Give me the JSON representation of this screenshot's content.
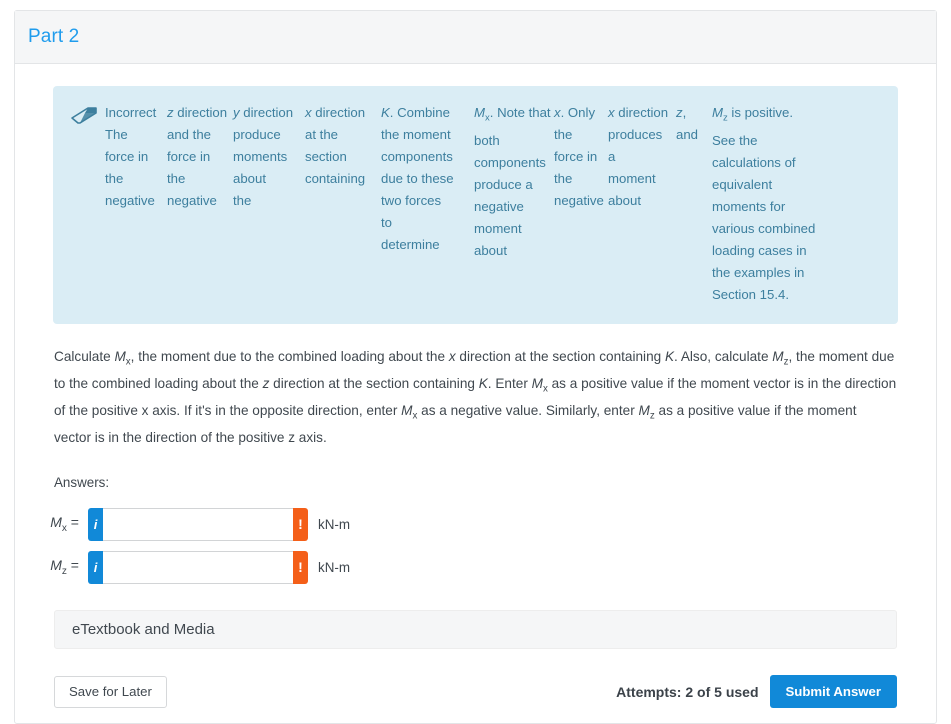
{
  "part": {
    "title": "Part 2"
  },
  "hint": {
    "icon": "eraser-icon",
    "columns": [
      [
        "Incorrect",
        "",
        "The",
        "force in",
        "the",
        "negative"
      ],
      [
        "z direction",
        "and the",
        "force in",
        "the",
        "negative"
      ],
      [
        "y direction",
        "produce",
        "moments",
        "about",
        "the"
      ],
      [
        "x direction",
        "at the",
        "section",
        "containing"
      ],
      [
        "K. Combine",
        "the moment",
        "components",
        "due to these",
        "two forces",
        "to",
        "determine"
      ],
      [
        "Mx. Note that",
        "both",
        "components",
        "produce a",
        "negative",
        "moment",
        "about"
      ],
      [
        "x. Only",
        "the",
        "force in",
        "the",
        "negative"
      ],
      [
        "x direction",
        "produces",
        "a",
        "moment",
        "about"
      ],
      [
        "z,",
        "and"
      ],
      [
        "Mz is positive.",
        "See the",
        "calculations of",
        "equivalent",
        "moments for",
        "various combined",
        "loading cases in",
        "the examples in",
        "Section 15.4."
      ]
    ]
  },
  "prompt": {
    "text": "Calculate Mx, the moment due to the combined loading about the x direction at the section containing K. Also, calculate Mz, the moment due to the combined loading about the z direction at the section containing K. Enter Mx as a positive value if the moment vector is in the direction of the positive x axis. If it's in the opposite direction, enter Mx as a negative value. Similarly, enter Mz as a positive value if the moment vector is in the direction of the positive z axis."
  },
  "answers": {
    "label": "Answers:",
    "rows": [
      {
        "label": "Mx =",
        "subscript": "x",
        "value": "",
        "placeholder": "",
        "info_glyph": "i",
        "alert_glyph": "!",
        "unit": "kN-m"
      },
      {
        "label": "Mz =",
        "subscript": "z",
        "value": "",
        "placeholder": "",
        "info_glyph": "i",
        "alert_glyph": "!",
        "unit": "kN-m"
      }
    ]
  },
  "etextbook": {
    "label": "eTextbook and Media"
  },
  "footer": {
    "save_label": "Save for Later",
    "attempts": "Attempts: 2 of 5 used",
    "submit_label": "Submit Answer"
  },
  "colors": {
    "accent_blue": "#1189d8",
    "title_blue": "#1f9ced",
    "hint_bg": "#daedf5",
    "hint_text": "#3d7f9e",
    "alert_orange": "#f45f19",
    "panel_gray": "#f5f6f7"
  }
}
